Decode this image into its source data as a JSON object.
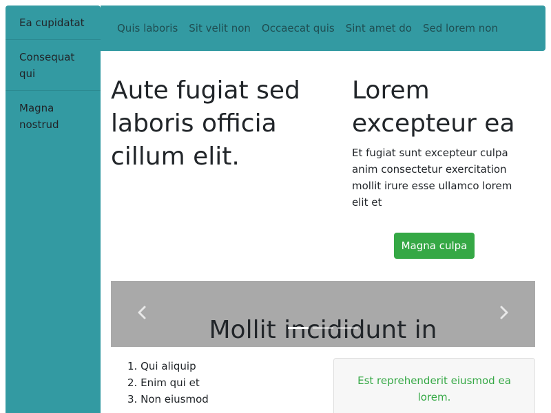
{
  "sidebar": {
    "items": [
      {
        "label": "Ea cupidatat"
      },
      {
        "label": "Consequat qui"
      },
      {
        "label": "Magna nostrud"
      }
    ]
  },
  "topnav": {
    "links": [
      {
        "label": "Quis laboris"
      },
      {
        "label": "Sit velit non"
      },
      {
        "label": "Occaecat quis"
      },
      {
        "label": "Sint amet do"
      },
      {
        "label": "Sed lorem non"
      }
    ]
  },
  "main": {
    "left_heading": "Aute fugiat sed laboris officia cillum elit.",
    "right_heading": "Lorem excepteur ea",
    "right_text": "Et fugiat sunt excepteur culpa anim consectetur exercitation mollit irure esse ullamco lorem elit et",
    "cta_label": "Magna culpa"
  },
  "carousel": {
    "caption": "Mollit incididunt in",
    "indicator_count": 3,
    "active_index": 0,
    "prev_icon": "chevron-left-icon",
    "next_icon": "chevron-right-icon"
  },
  "list": {
    "items": [
      {
        "label": "Qui aliquip"
      },
      {
        "label": "Enim qui et"
      },
      {
        "label": "Non eiusmod"
      }
    ]
  },
  "card": {
    "text": "Est reprehenderit eiusmod ea lorem."
  },
  "colors": {
    "teal": "#339aa2",
    "green": "#35a845",
    "carousel_bg": "#a9a9a9"
  }
}
